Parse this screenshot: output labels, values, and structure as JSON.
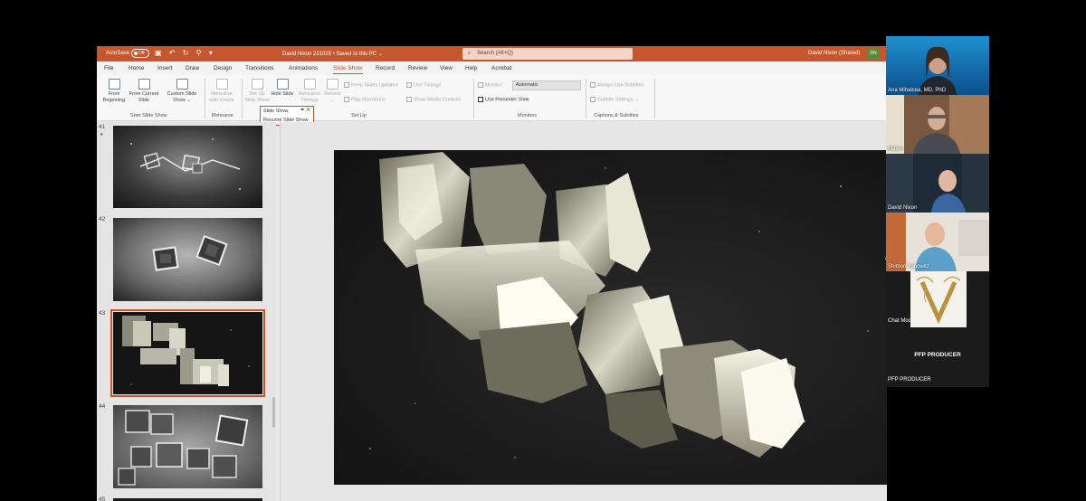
{
  "titlebar": {
    "autosave_label": "AutoSave",
    "autosave_state": "Off",
    "document_title": "David Nixon 221025 • Saved to this PC ⌄",
    "search_placeholder": "Search (Alt+Q)",
    "user_name": "David Nixon (Shared)",
    "user_initials": "DN",
    "accent_color": "#c6562e"
  },
  "tabs": [
    "File",
    "Home",
    "Insert",
    "Draw",
    "Design",
    "Transitions",
    "Animations",
    "Slide Show",
    "Record",
    "Review",
    "View",
    "Help",
    "Acrobat"
  ],
  "active_tab": "Slide Show",
  "ribbon": {
    "from_beginning": "From Beginning",
    "from_current": "From Current Slide",
    "custom_slide_show": "Custom Slide Show ⌄",
    "group_start": "Start Slide Show",
    "rehearse_coach": "Rehearse with Coach",
    "group_rehearse": "Rehearse",
    "set_up": "Set Up Slide Show",
    "hide_slide": "Hide Slide",
    "rehearse_timings": "Rehearse Timings",
    "record": "Record ⌄",
    "keep_updated": "Keep Slides Updated",
    "play_narrations": "Play Narrations",
    "use_timings": "Use Timings",
    "show_media_controls": "Show Media Controls",
    "group_setup": "Set Up",
    "monitor_label": "Monitor:",
    "monitor_value": "Automatic",
    "use_presenter_view": "Use Presenter View",
    "group_monitors": "Monitors",
    "always_subtitles": "Always Use Subtitles",
    "subtitle_settings": "Subtitle Settings ⌄",
    "group_captions": "Captions & Subtitles"
  },
  "popup": {
    "title": "Slide Show",
    "controls": "⏷ ✕",
    "resume": "Resume Slide Show"
  },
  "slides": [
    {
      "number": "41",
      "has_star": true
    },
    {
      "number": "42",
      "has_star": false
    },
    {
      "number": "43",
      "has_star": false,
      "selected": true
    },
    {
      "number": "44",
      "has_star": false
    },
    {
      "number": "45",
      "has_star": false
    }
  ],
  "star_glyph": "★",
  "participants": [
    {
      "name": "Ana Mihalcea, MD, PhD"
    },
    {
      "name": "Mateo"
    },
    {
      "name": "David Nixon"
    },
    {
      "name": "Shimon Yanowitz"
    }
  ],
  "chat_mod": "Chat Mod",
  "producer_center": "PFP PRODUCER",
  "producer_bottom": "PFP PRODUCER"
}
